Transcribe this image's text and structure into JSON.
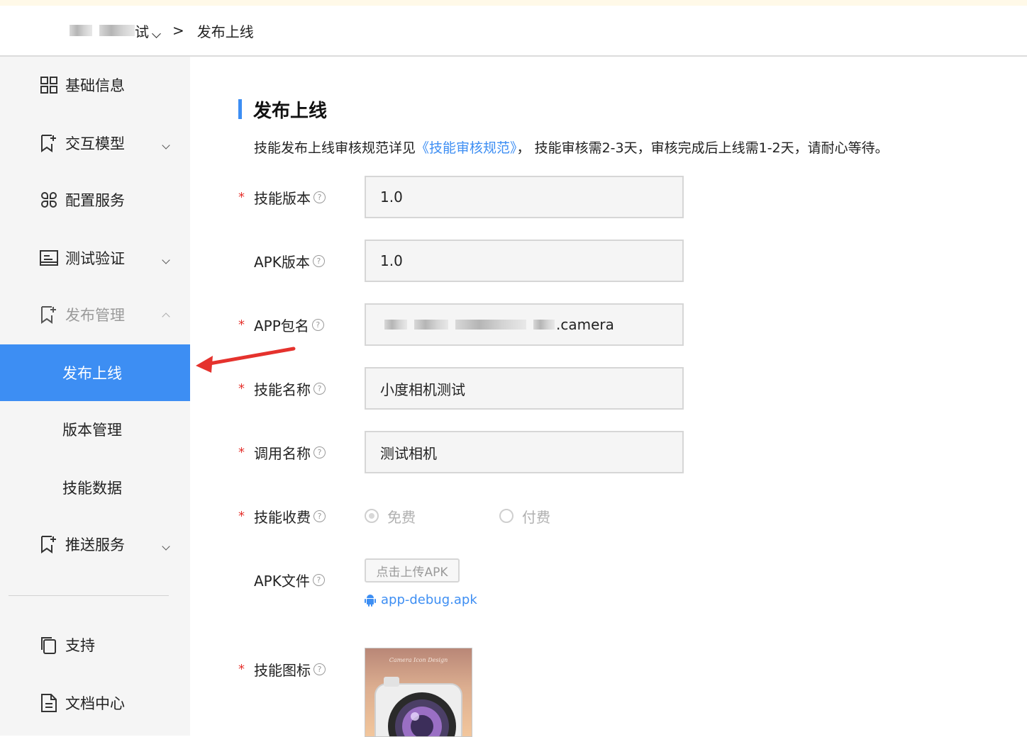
{
  "breadcrumb": {
    "parent": "试",
    "current": "发布上线"
  },
  "sidebar": {
    "items": [
      {
        "label": "基础信息"
      },
      {
        "label": "交互模型"
      },
      {
        "label": "配置服务"
      },
      {
        "label": "测试验证"
      },
      {
        "label": "发布管理"
      },
      {
        "label": "发布上线"
      },
      {
        "label": "版本管理"
      },
      {
        "label": "技能数据"
      },
      {
        "label": "推送服务"
      },
      {
        "label": "支持"
      },
      {
        "label": "文档中心"
      }
    ]
  },
  "main": {
    "title": "发布上线",
    "desc_prefix": "技能发布上线审核规范详见",
    "desc_link": "《技能审核规范》",
    "desc_suffix": "， 技能审核需2-3天，审核完成后上线需1-2天，请耐心等待。",
    "required_mark": "*",
    "help_glyph": "?",
    "fields": {
      "skill_version": {
        "label": "技能版本",
        "value": "1.0"
      },
      "apk_version": {
        "label": "APK版本",
        "value": "1.0"
      },
      "app_package": {
        "label": "APP包名",
        "value_suffix": ".camera"
      },
      "skill_name": {
        "label": "技能名称",
        "value": "小度相机测试"
      },
      "invoke_name": {
        "label": "调用名称",
        "value": "测试相机"
      },
      "charge": {
        "label": "技能收费",
        "option_free": "免费",
        "option_paid": "付费"
      },
      "apk_file": {
        "label": "APK文件",
        "upload_label": "点击上传APK",
        "file_name": "app-debug.apk"
      },
      "skill_icon": {
        "label": "技能图标",
        "image_caption": "Camera Icon Design"
      }
    }
  },
  "colors": {
    "accent": "#3d8ef3",
    "required": "#e5322d",
    "annotation_arrow": "#e5322d"
  }
}
